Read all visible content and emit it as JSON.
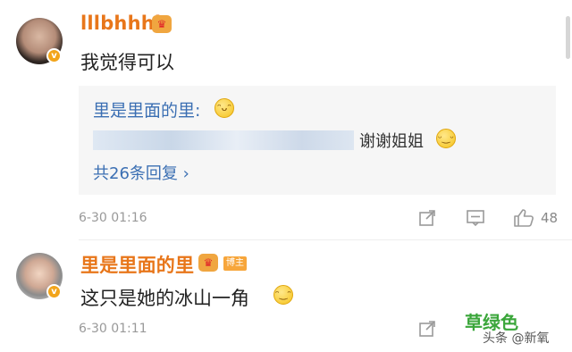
{
  "comment1": {
    "username": "lllbhhhh",
    "text": "我觉得可以",
    "reply": {
      "author": "里是里面的里:",
      "text": "谢谢姐姐",
      "count_label": "共26条回复 ›"
    },
    "time": "6-30 01:16",
    "likes": "48"
  },
  "comment2": {
    "username": "里是里面的里",
    "owner_badge": "博主",
    "text": "这只是她的冰山一角",
    "time": "6-30 01:11"
  },
  "watermark": {
    "brand": "草绿色",
    "source": "头条 @新氧"
  },
  "colors": {
    "username": "#e8761a",
    "link": "#3b6fb3",
    "verified": "#f2a41a",
    "watermark": "#3aa63a"
  },
  "icons": [
    "share-icon",
    "comment-icon",
    "like-icon",
    "crown-badge-icon",
    "verified-icon",
    "emoji-icon"
  ]
}
